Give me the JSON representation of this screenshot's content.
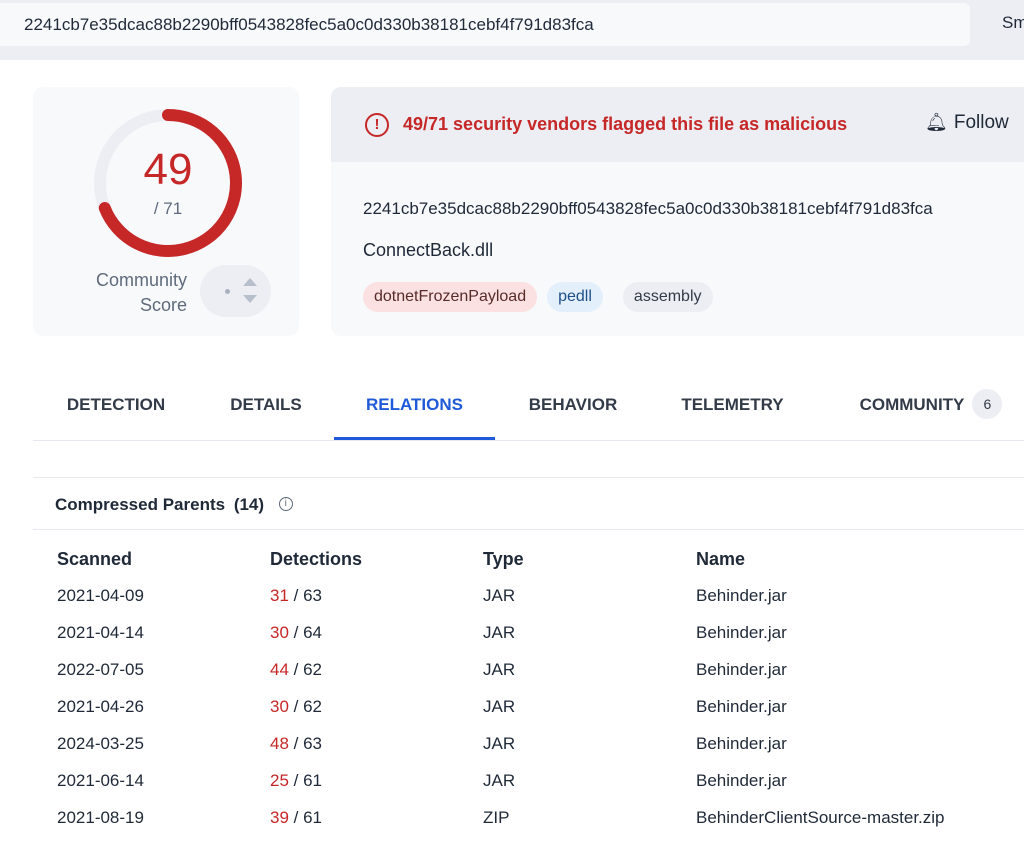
{
  "topbar": {
    "search_value": "2241cb7e35dcac88b2290bff0543828fec5a0c0d330b38181cebf4f791d83fca",
    "right_text": "Sm"
  },
  "score": {
    "detected": "49",
    "total": "/ 71",
    "detected_fraction": 0.69,
    "community_label_line1": "Community",
    "community_label_line2": "Score",
    "accent_color": "#c62828"
  },
  "alert": {
    "icon": "exclamation-circle-icon",
    "text": "49/71 security vendors flagged this file as malicious",
    "follow_label": "Follow",
    "follow_icon": "bell-icon"
  },
  "file": {
    "hash": "2241cb7e35dcac88b2290bff0543828fec5a0c0d330b38181cebf4f791d83fca",
    "name": "ConnectBack.dll",
    "tags": [
      "dotnetFrozenPayload",
      "pedll",
      "assembly"
    ]
  },
  "tabs": [
    {
      "label": "DETECTION"
    },
    {
      "label": "DETAILS"
    },
    {
      "label": "RELATIONS",
      "active": true
    },
    {
      "label": "BEHAVIOR"
    },
    {
      "label": "TELEMETRY"
    },
    {
      "label": "COMMUNITY",
      "badge": "6"
    }
  ],
  "section": {
    "title": "Compressed Parents",
    "count": "(14)",
    "columns": [
      "Scanned",
      "Detections",
      "Type",
      "Name"
    ],
    "rows": [
      {
        "scanned": "2021-04-09",
        "positives": "31",
        "total": "/ 63",
        "type": "JAR",
        "name": "Behinder.jar"
      },
      {
        "scanned": "2021-04-14",
        "positives": "30",
        "total": "/ 64",
        "type": "JAR",
        "name": "Behinder.jar"
      },
      {
        "scanned": "2022-07-05",
        "positives": "44",
        "total": "/ 62",
        "type": "JAR",
        "name": "Behinder.jar"
      },
      {
        "scanned": "2021-04-26",
        "positives": "30",
        "total": "/ 62",
        "type": "JAR",
        "name": "Behinder.jar"
      },
      {
        "scanned": "2024-03-25",
        "positives": "48",
        "total": "/ 63",
        "type": "JAR",
        "name": "Behinder.jar"
      },
      {
        "scanned": "2021-06-14",
        "positives": "25",
        "total": "/ 61",
        "type": "JAR",
        "name": "Behinder.jar"
      },
      {
        "scanned": "2021-08-19",
        "positives": "39",
        "total": "/ 61",
        "type": "ZIP",
        "name": "BehinderClientSource-master.zip"
      }
    ]
  }
}
